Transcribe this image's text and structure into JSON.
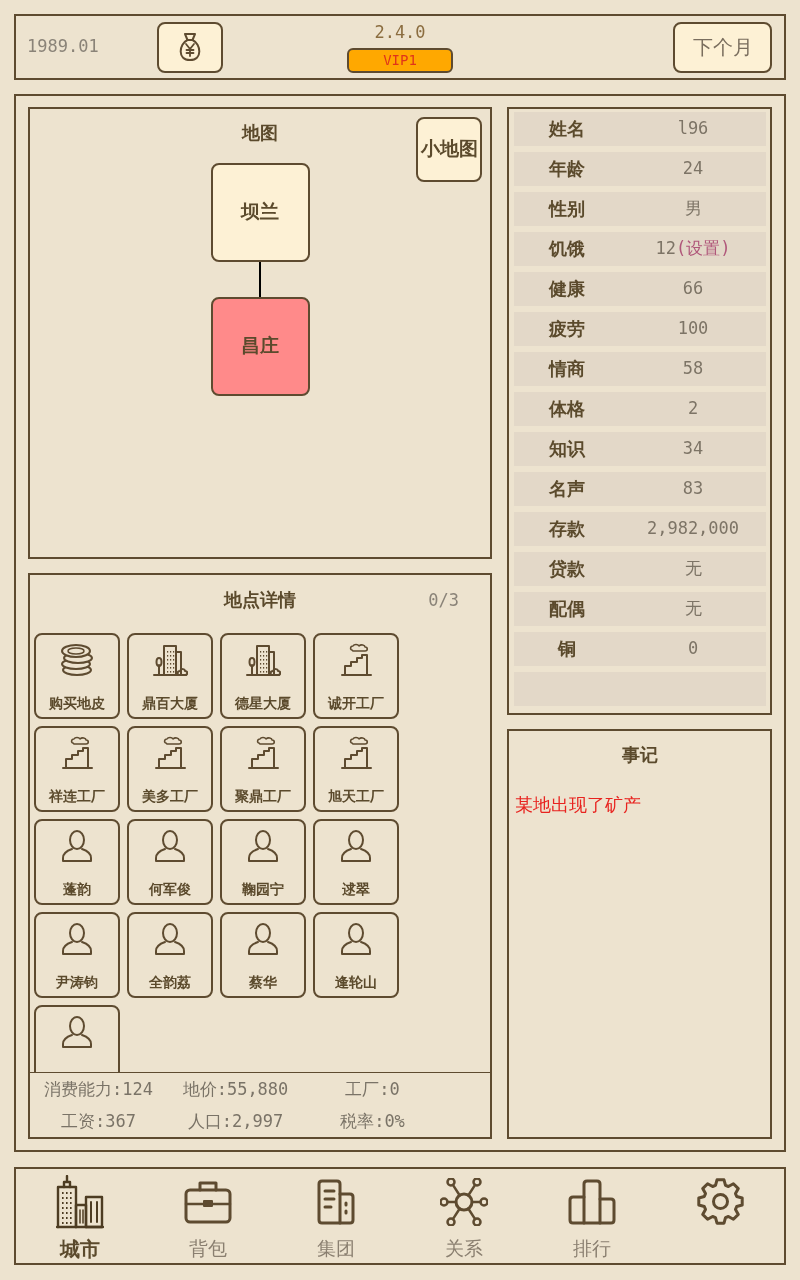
{
  "top_bar": {
    "date": "1989.01",
    "version": "2.4.0",
    "vip": "VIP1",
    "next_button": "下个月"
  },
  "map": {
    "title": "地图",
    "minimap_button": "小地图",
    "nodes": [
      {
        "name": "坝兰",
        "selected": false
      },
      {
        "name": "昌庄",
        "selected": true
      }
    ]
  },
  "location": {
    "title": "地点详情",
    "count": "0/3",
    "items": [
      {
        "kind": "coins",
        "label": "购买地皮"
      },
      {
        "kind": "building",
        "label": "鼎百大厦"
      },
      {
        "kind": "building",
        "label": "德星大厦"
      },
      {
        "kind": "factory",
        "label": "诚开工厂"
      },
      {
        "kind": "factory",
        "label": "祥连工厂"
      },
      {
        "kind": "factory",
        "label": "美多工厂"
      },
      {
        "kind": "factory",
        "label": "聚鼎工厂"
      },
      {
        "kind": "factory",
        "label": "旭天工厂"
      },
      {
        "kind": "person",
        "label": "蓬韵"
      },
      {
        "kind": "person",
        "label": "何军俊"
      },
      {
        "kind": "person",
        "label": "鞠园宁"
      },
      {
        "kind": "person",
        "label": "逑翠"
      },
      {
        "kind": "person",
        "label": "尹涛钧"
      },
      {
        "kind": "person",
        "label": "全韵荔"
      },
      {
        "kind": "person",
        "label": "蔡华"
      },
      {
        "kind": "person",
        "label": "逢轮山"
      },
      {
        "kind": "person"
      }
    ],
    "stats": [
      "消费能力:124",
      "地价:55,880",
      "工厂:0",
      "工资:367",
      "人口:2,997",
      "税率:0%"
    ]
  },
  "profile": {
    "rows": [
      {
        "kind": "field",
        "label": "姓名",
        "value": "l96"
      },
      {
        "kind": "field",
        "label": "年龄",
        "value": "24"
      },
      {
        "kind": "field",
        "label": "性别",
        "value": "男"
      },
      {
        "kind": "field",
        "label": "饥饿",
        "value": "12",
        "action": "(设置)"
      },
      {
        "kind": "field",
        "label": "健康",
        "value": "66"
      },
      {
        "kind": "field",
        "label": "疲劳",
        "value": "100"
      },
      {
        "kind": "field",
        "label": "情商",
        "value": "58"
      },
      {
        "kind": "field",
        "label": "体格",
        "value": "2"
      },
      {
        "kind": "field",
        "label": "知识",
        "value": "34"
      },
      {
        "kind": "field",
        "label": "名声",
        "value": "83"
      },
      {
        "kind": "field",
        "label": "存款",
        "value": "2,982,000"
      },
      {
        "kind": "field",
        "label": "贷款",
        "value": "无"
      },
      {
        "kind": "field",
        "label": "配偶",
        "value": "无"
      },
      {
        "kind": "field",
        "label": "铜",
        "value": "0"
      },
      {
        "kind": "blank"
      }
    ]
  },
  "events": {
    "title": "事记",
    "entries": [
      "某地出现了矿产"
    ]
  },
  "tabs": [
    {
      "kind": "city",
      "label": "城市",
      "selected": true
    },
    {
      "kind": "bag",
      "label": "背包",
      "selected": false
    },
    {
      "kind": "group",
      "label": "集团",
      "selected": false
    },
    {
      "kind": "relations",
      "label": "关系",
      "selected": false
    },
    {
      "kind": "ranking",
      "label": "排行",
      "selected": false
    },
    {
      "kind": "settings",
      "selected": false
    }
  ]
}
